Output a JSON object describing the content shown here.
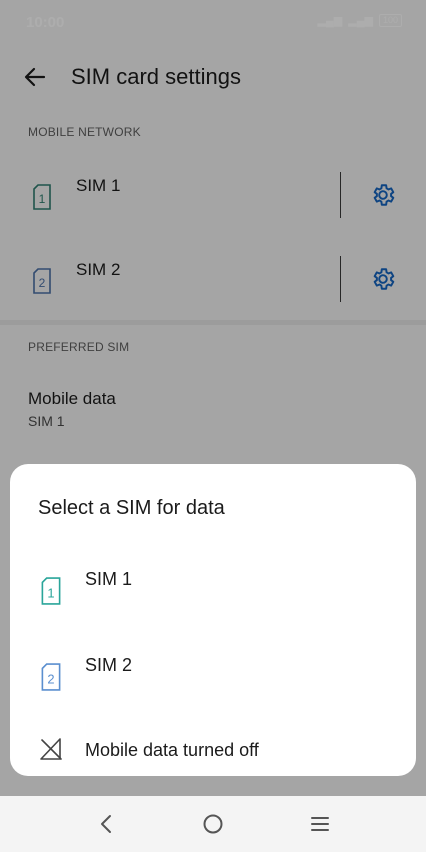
{
  "status": {
    "time": "10:00",
    "signal1": "▂▄▆",
    "signal2": "▂▄▆",
    "battery": "100"
  },
  "appbar": {
    "title": "SIM card settings"
  },
  "mobile_network": {
    "label": "MOBILE NETWORK",
    "sims": [
      {
        "name": "SIM 1",
        "number": "1",
        "color": "#2e7d6f"
      },
      {
        "name": "SIM 2",
        "number": "2",
        "color": "#4a6fa5"
      }
    ]
  },
  "preferred_sim": {
    "label": "PREFERRED SIM",
    "mobile_data_title": "Mobile data",
    "mobile_data_value": "SIM 1"
  },
  "dialog": {
    "title": "Select a SIM for data",
    "options": [
      {
        "label": "SIM 1",
        "number": "1",
        "icon": "sim1-icon",
        "color": "#2aa59a"
      },
      {
        "label": "SIM 2",
        "number": "2",
        "icon": "sim2-icon",
        "color": "#5b8fcf"
      },
      {
        "label": "Mobile data turned off",
        "icon": "mobile-data-off-icon",
        "color": "#444444"
      }
    ]
  },
  "colors": {
    "accent": "#1565c0",
    "scrim": "rgba(0,0,0,0.32)"
  }
}
